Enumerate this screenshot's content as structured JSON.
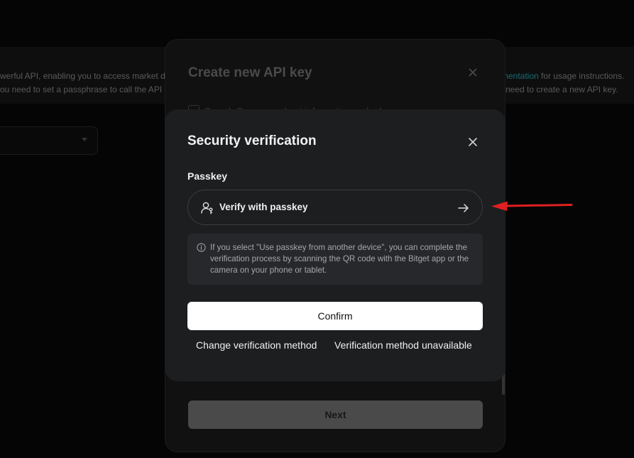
{
  "background": {
    "banner_line1": "werful API, enabling you to access market da",
    "banner_line2": "ou need to set a passphrase to call the API a",
    "banner_right1_link": "mentation",
    "banner_right1_text": " for usage instructions.",
    "banner_right2": "need to create a new API key."
  },
  "api_dialog": {
    "title": "Create new API key",
    "permission_row": "Search    Query merchant information and ads",
    "next_label": "Next"
  },
  "security_modal": {
    "title": "Security verification",
    "section_label": "Passkey",
    "passkey_button_label": "Verify with passkey",
    "info_text": "If you select \"Use passkey from another device\", you can complete the verification process by scanning the QR code with the Bitget app or the camera on your phone or tablet.",
    "confirm_label": "Confirm",
    "change_method_label": "Change verification method",
    "unavailable_label": "Verification method unavailable"
  },
  "icons": {
    "close": "close-icon",
    "user": "user-passkey-icon",
    "arrow": "arrow-right-icon",
    "info": "info-icon"
  },
  "colors": {
    "modal_bg": "#1d1e20",
    "confirm_bg": "#ffffff",
    "annotation": "#e02020"
  }
}
